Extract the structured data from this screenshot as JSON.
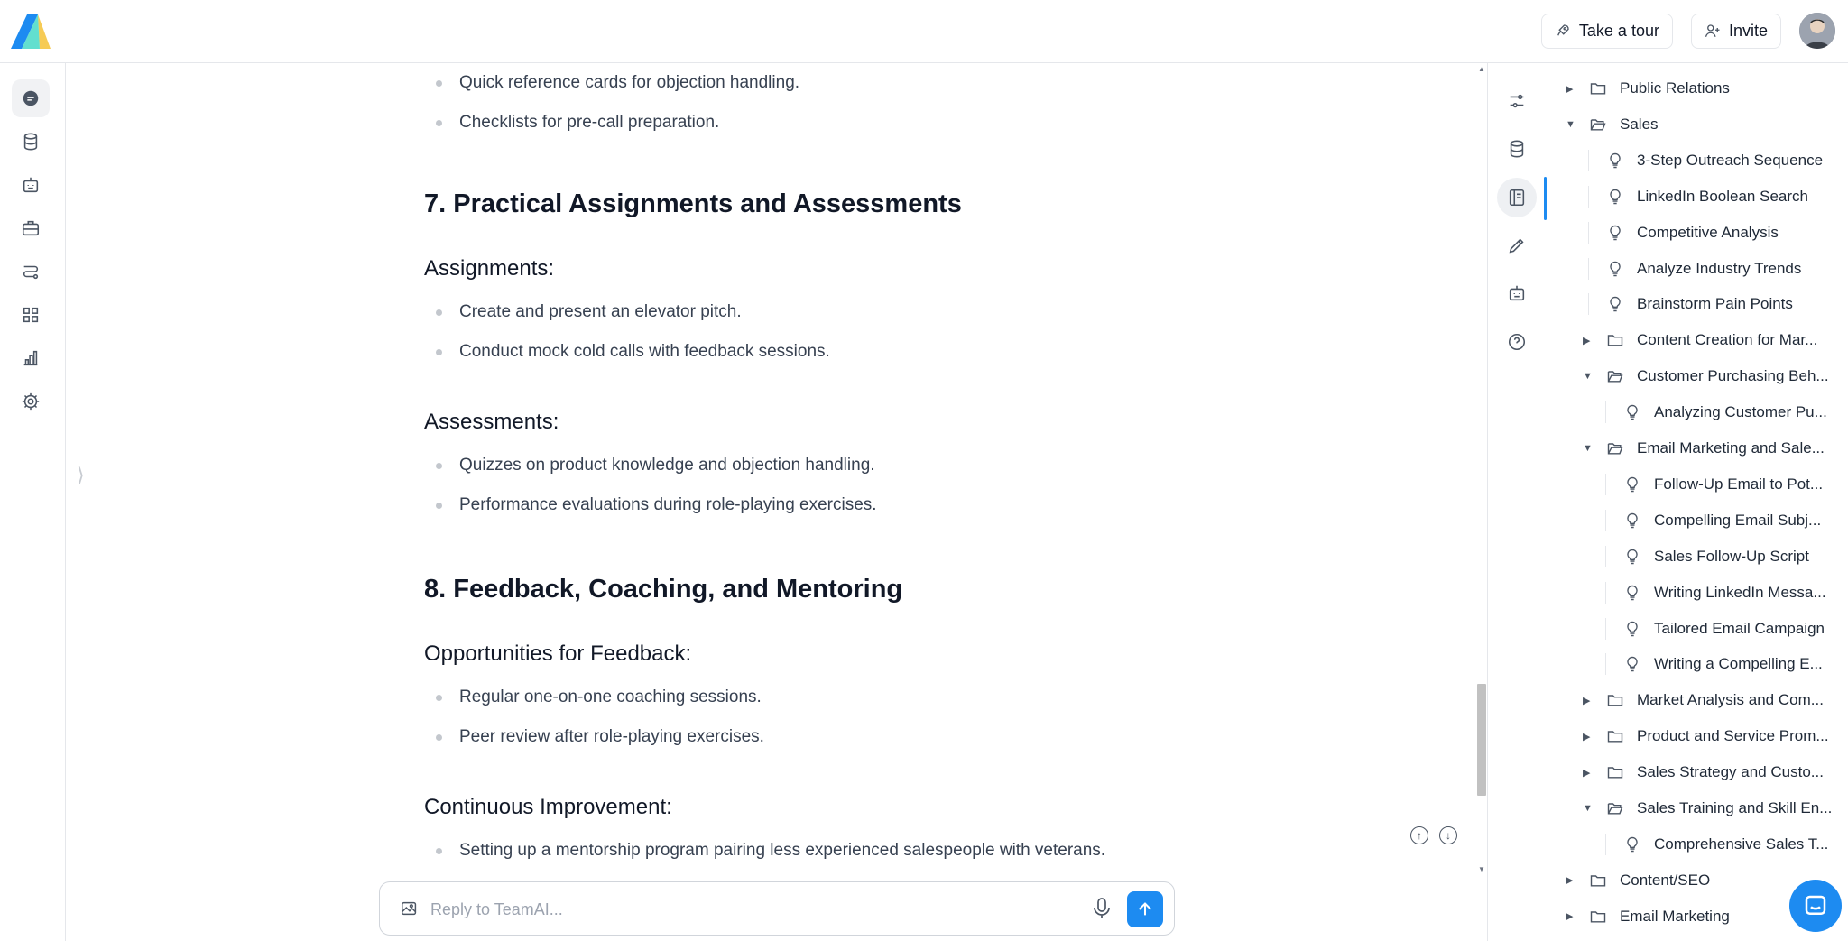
{
  "header": {
    "tour_label": "Take a tour",
    "invite_label": "Invite"
  },
  "left_nav": {
    "items": [
      {
        "icon": "chat-icon",
        "active": true
      },
      {
        "icon": "database-icon"
      },
      {
        "icon": "bot-icon"
      },
      {
        "icon": "briefcase-icon"
      },
      {
        "icon": "route-icon"
      },
      {
        "icon": "apps-grid-icon"
      },
      {
        "icon": "bar-chart-icon"
      },
      {
        "icon": "gear-icon"
      }
    ]
  },
  "document": {
    "top_bullets": [
      "Quick reference cards for objection handling.",
      "Checklists for pre-call preparation."
    ],
    "section7": {
      "title": "7. Practical Assignments and Assessments",
      "assignments_heading": "Assignments:",
      "assignments": [
        "Create and present an elevator pitch.",
        "Conduct mock cold calls with feedback sessions."
      ],
      "assessments_heading": "Assessments:",
      "assessments": [
        "Quizzes on product knowledge and objection handling.",
        "Performance evaluations during role-playing exercises."
      ]
    },
    "section8": {
      "title": "8. Feedback, Coaching, and Mentoring",
      "feedback_heading": "Opportunities for Feedback:",
      "feedback": [
        "Regular one-on-one coaching sessions.",
        "Peer review after role-playing exercises."
      ],
      "improvement_heading": "Continuous Improvement:",
      "improvement": [
        "Setting up a mentorship program pairing less experienced salespeople with veterans."
      ]
    }
  },
  "composer": {
    "placeholder": "Reply to TeamAI..."
  },
  "tool_rail": {
    "items": [
      "sliders-icon",
      "database-icon",
      "notebook-icon",
      "pencil-icon",
      "bot-icon",
      "help-icon"
    ],
    "active_index": 2
  },
  "tree": {
    "rows": [
      {
        "label": "Public Relations",
        "type": "folder",
        "depth": 0,
        "expanded": false
      },
      {
        "label": "Sales",
        "type": "folder",
        "depth": 0,
        "expanded": true
      },
      {
        "label": "3-Step Outreach Sequence",
        "type": "prompt",
        "depth": 1
      },
      {
        "label": "LinkedIn Boolean Search",
        "type": "prompt",
        "depth": 1
      },
      {
        "label": "Competitive Analysis",
        "type": "prompt",
        "depth": 1
      },
      {
        "label": "Analyze Industry Trends",
        "type": "prompt",
        "depth": 1
      },
      {
        "label": "Brainstorm Pain Points",
        "type": "prompt",
        "depth": 1
      },
      {
        "label": "Content Creation for Mar...",
        "type": "folder",
        "depth": 1,
        "expanded": false
      },
      {
        "label": "Customer Purchasing Beh...",
        "type": "folder",
        "depth": 1,
        "expanded": true
      },
      {
        "label": "Analyzing Customer Pu...",
        "type": "prompt",
        "depth": 2
      },
      {
        "label": "Email Marketing and Sale...",
        "type": "folder",
        "depth": 1,
        "expanded": true
      },
      {
        "label": "Follow-Up Email to Pot...",
        "type": "prompt",
        "depth": 2
      },
      {
        "label": "Compelling Email Subj...",
        "type": "prompt",
        "depth": 2
      },
      {
        "label": "Sales Follow-Up Script",
        "type": "prompt",
        "depth": 2
      },
      {
        "label": "Writing LinkedIn Messa...",
        "type": "prompt",
        "depth": 2
      },
      {
        "label": "Tailored Email Campaign",
        "type": "prompt",
        "depth": 2
      },
      {
        "label": "Writing a Compelling E...",
        "type": "prompt",
        "depth": 2
      },
      {
        "label": "Market Analysis and Com...",
        "type": "folder",
        "depth": 1,
        "expanded": false
      },
      {
        "label": "Product and Service Prom...",
        "type": "folder",
        "depth": 1,
        "expanded": false
      },
      {
        "label": "Sales Strategy and Custo...",
        "type": "folder",
        "depth": 1,
        "expanded": false
      },
      {
        "label": "Sales Training and Skill En...",
        "type": "folder",
        "depth": 1,
        "expanded": true
      },
      {
        "label": "Comprehensive Sales T...",
        "type": "prompt",
        "depth": 2
      },
      {
        "label": "Content/SEO",
        "type": "folder",
        "depth": 0,
        "expanded": false
      },
      {
        "label": "Email Marketing",
        "type": "folder",
        "depth": 0,
        "expanded": false
      }
    ]
  },
  "colors": {
    "accent": "#1d8bf1",
    "border": "#e5e7eb",
    "text": "#1f2937",
    "muted": "#9ca3af"
  }
}
